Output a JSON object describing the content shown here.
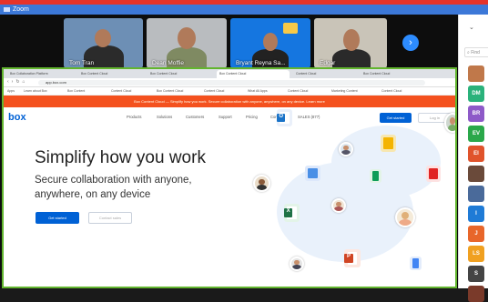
{
  "window": {
    "title": "Zoom"
  },
  "participants": [
    {
      "name": "Tom Tran",
      "bg": "#6d8fb5",
      "shirt": "#2b2b2b"
    },
    {
      "name": "Dean Moffie",
      "bg": "#b9bcbf",
      "shirt": "#7f8a62"
    },
    {
      "name": "Bryant Reyna Sa...",
      "bg": "#1576e0",
      "shirt": "#222"
    },
    {
      "name": "Edgar",
      "bg": "#c9c4b8",
      "shirt": "#2a2a2a"
    }
  ],
  "next_label": "›",
  "browser": {
    "tabs": [
      "Box Collaboration Platform",
      "Box Content Cloud",
      "Box Content Cloud",
      "Box Content Cloud",
      "Content Cloud",
      "Box Content Cloud"
    ],
    "url": "app.box.com",
    "bookmarks": [
      "Apps",
      "Learn about Box",
      "Box Content",
      "Content Cloud",
      "Box Content Cloud",
      "Content Cloud",
      "What All Apps",
      "Content Cloud",
      "Marketing Content",
      "Content Cloud"
    ],
    "banner": "Box Content Cloud — Simplify how you work. Secure collaboration with anyone, anywhere, on any device. Learn more"
  },
  "box": {
    "logo": "box",
    "menu": [
      "Products",
      "Solutions",
      "Customers",
      "Support",
      "Pricing",
      "Contact",
      "SALES (877)"
    ],
    "get_started": "Get started",
    "login": "Log in",
    "hero": "Simplify how you work",
    "sub1": "Secure collaboration with anyone,",
    "sub2": "anywhere, on any device",
    "btn_primary": "Get started",
    "btn_secondary": "Contact sales"
  },
  "panel": {
    "search_placeholder": "Find",
    "avatars": [
      {
        "initials": "",
        "color": "#c0784a"
      },
      {
        "initials": "DM",
        "color": "#2ab27b"
      },
      {
        "initials": "BR",
        "color": "#8e5ac8"
      },
      {
        "initials": "EV",
        "color": "#2aa84a"
      },
      {
        "initials": "EI",
        "color": "#e0532b"
      },
      {
        "initials": "",
        "color": "#6a4a3a"
      },
      {
        "initials": "",
        "color": "#4a6a9a"
      },
      {
        "initials": "I",
        "color": "#1f7bd6"
      },
      {
        "initials": "J",
        "color": "#e8662a"
      },
      {
        "initials": "LS",
        "color": "#f0a020"
      },
      {
        "initials": "S",
        "color": "#444"
      },
      {
        "initials": "",
        "color": "#7a3a2a"
      }
    ]
  }
}
